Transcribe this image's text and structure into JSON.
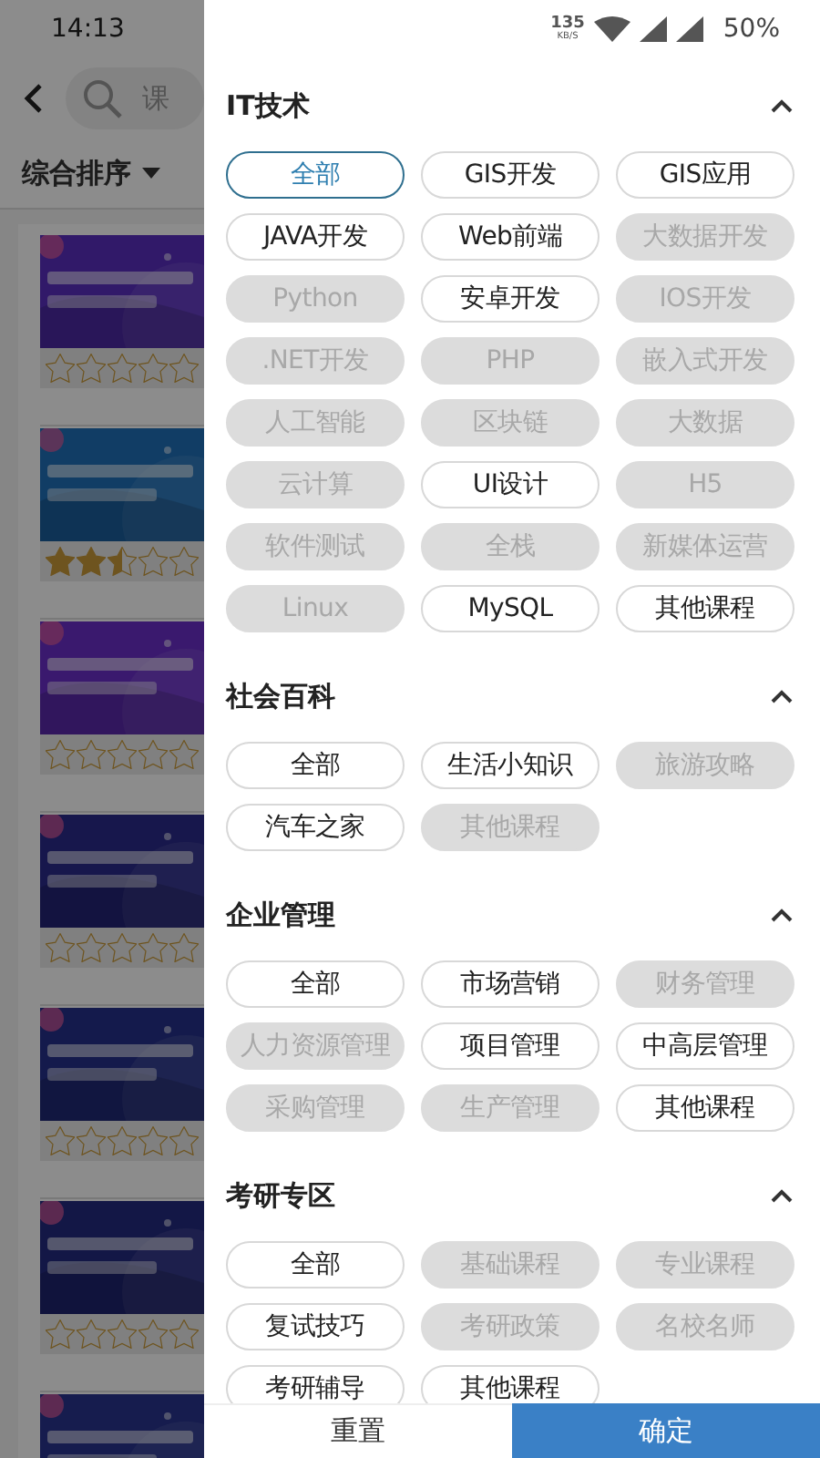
{
  "status_bar": {
    "time": "14:13",
    "speed": "135",
    "speed_unit": "KB/S",
    "battery": "50%"
  },
  "page": {
    "search": {
      "placeholder": "课"
    },
    "sort": {
      "label": "综合排序"
    },
    "courses": [
      {
        "kind": "picture",
        "stars": 0
      },
      {
        "kind": "picture",
        "stars": 2.5
      },
      {
        "kind": "picture",
        "stars": 0
      },
      {
        "kind": "picture",
        "stars": 0
      },
      {
        "kind": "picture",
        "stars": 0
      },
      {
        "kind": "picture",
        "stars": 0
      },
      {
        "kind": "picture"
      }
    ]
  },
  "filter": {
    "sections": [
      {
        "title": "IT技术",
        "expanded": true,
        "options": [
          {
            "label": "全部",
            "selected": true,
            "disabled": false
          },
          {
            "label": "GIS开发",
            "selected": false,
            "disabled": false
          },
          {
            "label": "GIS应用",
            "selected": false,
            "disabled": false
          },
          {
            "label": "JAVA开发",
            "selected": false,
            "disabled": false
          },
          {
            "label": "Web前端",
            "selected": false,
            "disabled": false
          },
          {
            "label": "大数据开发",
            "selected": false,
            "disabled": true
          },
          {
            "label": "Python",
            "selected": false,
            "disabled": true
          },
          {
            "label": "安卓开发",
            "selected": false,
            "disabled": false
          },
          {
            "label": "IOS开发",
            "selected": false,
            "disabled": true
          },
          {
            "label": ".NET开发",
            "selected": false,
            "disabled": true
          },
          {
            "label": "PHP",
            "selected": false,
            "disabled": true
          },
          {
            "label": "嵌入式开发",
            "selected": false,
            "disabled": true
          },
          {
            "label": "人工智能",
            "selected": false,
            "disabled": true
          },
          {
            "label": "区块链",
            "selected": false,
            "disabled": true
          },
          {
            "label": "大数据",
            "selected": false,
            "disabled": true
          },
          {
            "label": "云计算",
            "selected": false,
            "disabled": true
          },
          {
            "label": "UI设计",
            "selected": false,
            "disabled": false
          },
          {
            "label": "H5",
            "selected": false,
            "disabled": true
          },
          {
            "label": "软件测试",
            "selected": false,
            "disabled": true
          },
          {
            "label": "全栈",
            "selected": false,
            "disabled": true
          },
          {
            "label": "新媒体运营",
            "selected": false,
            "disabled": true
          },
          {
            "label": "Linux",
            "selected": false,
            "disabled": true
          },
          {
            "label": "MySQL",
            "selected": false,
            "disabled": false
          },
          {
            "label": "其他课程",
            "selected": false,
            "disabled": false
          }
        ]
      },
      {
        "title": "社会百科",
        "expanded": true,
        "options": [
          {
            "label": "全部",
            "selected": false,
            "disabled": false
          },
          {
            "label": "生活小知识",
            "selected": false,
            "disabled": false
          },
          {
            "label": "旅游攻略",
            "selected": false,
            "disabled": true
          },
          {
            "label": "汽车之家",
            "selected": false,
            "disabled": false
          },
          {
            "label": "其他课程",
            "selected": false,
            "disabled": true
          }
        ]
      },
      {
        "title": "企业管理",
        "expanded": true,
        "options": [
          {
            "label": "全部",
            "selected": false,
            "disabled": false
          },
          {
            "label": "市场营销",
            "selected": false,
            "disabled": false
          },
          {
            "label": "财务管理",
            "selected": false,
            "disabled": true
          },
          {
            "label": "人力资源管理",
            "selected": false,
            "disabled": true
          },
          {
            "label": "项目管理",
            "selected": false,
            "disabled": false
          },
          {
            "label": "中高层管理",
            "selected": false,
            "disabled": false
          },
          {
            "label": "采购管理",
            "selected": false,
            "disabled": true
          },
          {
            "label": "生产管理",
            "selected": false,
            "disabled": true
          },
          {
            "label": "其他课程",
            "selected": false,
            "disabled": false
          }
        ]
      },
      {
        "title": "考研专区",
        "expanded": true,
        "options": [
          {
            "label": "全部",
            "selected": false,
            "disabled": false
          },
          {
            "label": "基础课程",
            "selected": false,
            "disabled": true
          },
          {
            "label": "专业课程",
            "selected": false,
            "disabled": true
          },
          {
            "label": "复试技巧",
            "selected": false,
            "disabled": false
          },
          {
            "label": "考研政策",
            "selected": false,
            "disabled": true
          },
          {
            "label": "名校名师",
            "selected": false,
            "disabled": true
          },
          {
            "label": "考研辅导",
            "selected": false,
            "disabled": false
          },
          {
            "label": "其他课程",
            "selected": false,
            "disabled": false
          }
        ]
      }
    ],
    "buttons": [
      {
        "label": "重置",
        "kind": "secondary"
      },
      {
        "label": "确定",
        "kind": "primary"
      }
    ]
  }
}
